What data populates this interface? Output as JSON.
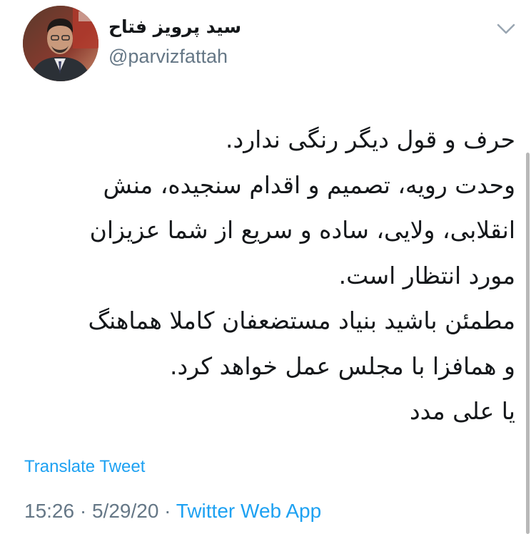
{
  "author": {
    "display_name": "سید پرویز فتاح",
    "handle": "@parvizfattah"
  },
  "tweet": {
    "lines": [
      "حرف و قول دیگر رنگی ندارد.",
      "وحدت رویه، تصمیم و اقدام سنجیده، منش",
      "انقلابی، ولایی، ساده و سریع از شما عزیزان",
      "مورد انتظار است.",
      "مطمئن باشید بنیاد مستضعفان کاملا هماهنگ",
      "و همافزا با مجلس عمل خواهد کرد.",
      "یا علی مدد"
    ]
  },
  "translate_label": "Translate Tweet",
  "meta": {
    "time": "15:26",
    "separator": "·",
    "date": "5/29/20",
    "source": "Twitter Web App"
  },
  "colors": {
    "accent": "#1da1f2",
    "secondary_text": "#657786",
    "primary_text": "#14171a"
  },
  "icons": {
    "menu": "chevron-down-icon"
  }
}
